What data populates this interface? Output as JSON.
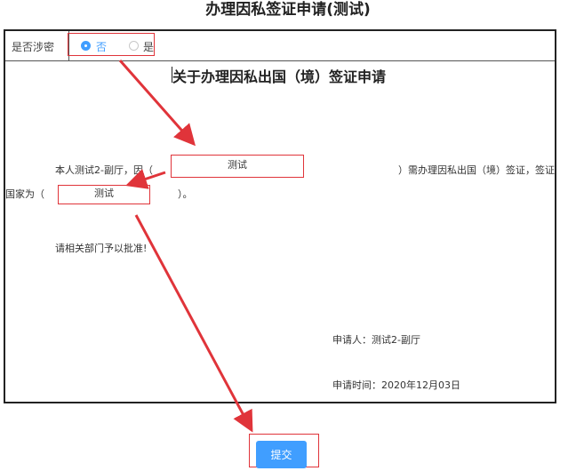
{
  "page_title": "办理因私签证申请(测试)",
  "secret": {
    "label": "是否涉密",
    "options": [
      "否",
      "是"
    ],
    "selected": "否"
  },
  "document": {
    "title": "关于办理因私出国（境）签证申请",
    "line1_prefix": "本人测试2-副厅，因（",
    "reason_value": "测试",
    "line1_suffix": "）需办理因私出国（境）签证，签证",
    "line2_prefix": "国家为（",
    "country_value": "测试",
    "line2_suffix": "）。",
    "closing": "请相关部门予以批准!",
    "applicant": "申请人：测试2-副厅",
    "apply_time": "申请时间：2020年12月03日"
  },
  "actions": {
    "submit_label": "提交"
  },
  "colors": {
    "accent": "#409eff",
    "annotation": "#e0343a"
  }
}
